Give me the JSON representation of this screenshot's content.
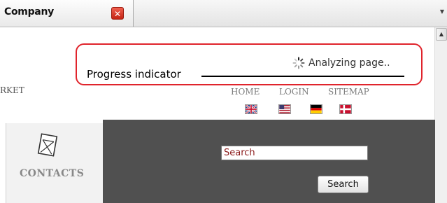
{
  "tab": {
    "title": "Company",
    "close_glyph": "✕",
    "dropdown_glyph": "▼"
  },
  "scrollbar": {
    "up_glyph": "▲"
  },
  "header": {
    "left_fragment": "RKET"
  },
  "callout": {
    "label": "Progress indicator",
    "status_text": "Analyzing page..",
    "border_color": "#e0242c"
  },
  "nav": {
    "home": "HOME",
    "login": "LOGIN",
    "sitemap": "SITEMAP"
  },
  "flags": [
    "uk-flag-icon",
    "us-flag-icon",
    "de-flag-icon",
    "dk-flag-icon"
  ],
  "sidebar": {
    "contacts_label": "CONTACTS"
  },
  "search": {
    "input_value": "Search",
    "button_label": "Search"
  },
  "colors": {
    "dark_panel": "#505050",
    "accent_red": "#e0242c"
  }
}
